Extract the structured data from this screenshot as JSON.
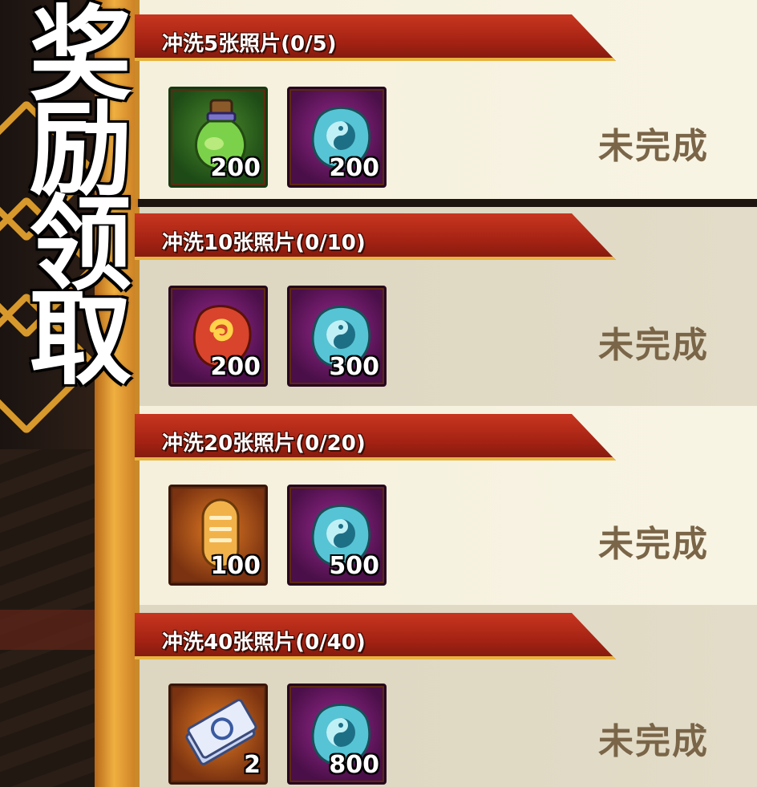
{
  "title": "奖励领取",
  "status_text": "未完成",
  "rows": [
    {
      "label": "冲洗5张照片(0/5)",
      "items": [
        {
          "icon": "green-potion-icon",
          "qty": "200"
        },
        {
          "icon": "yin-yang-stone-icon",
          "qty": "200"
        }
      ],
      "status": "未完成"
    },
    {
      "label": "冲洗10张照片(0/10)",
      "items": [
        {
          "icon": "red-magatama-stone-icon",
          "qty": "200"
        },
        {
          "icon": "yin-yang-stone-icon",
          "qty": "300"
        }
      ],
      "status": "未完成"
    },
    {
      "label": "冲洗20张照片(0/20)",
      "items": [
        {
          "icon": "gold-scroll-icon",
          "qty": "100"
        },
        {
          "icon": "yin-yang-stone-icon",
          "qty": "500"
        }
      ],
      "status": "未完成"
    },
    {
      "label": "冲洗40张照片(0/40)",
      "items": [
        {
          "icon": "ticket-icon",
          "qty": "2"
        },
        {
          "icon": "yin-yang-stone-icon",
          "qty": "800"
        }
      ],
      "status": "未完成"
    }
  ]
}
